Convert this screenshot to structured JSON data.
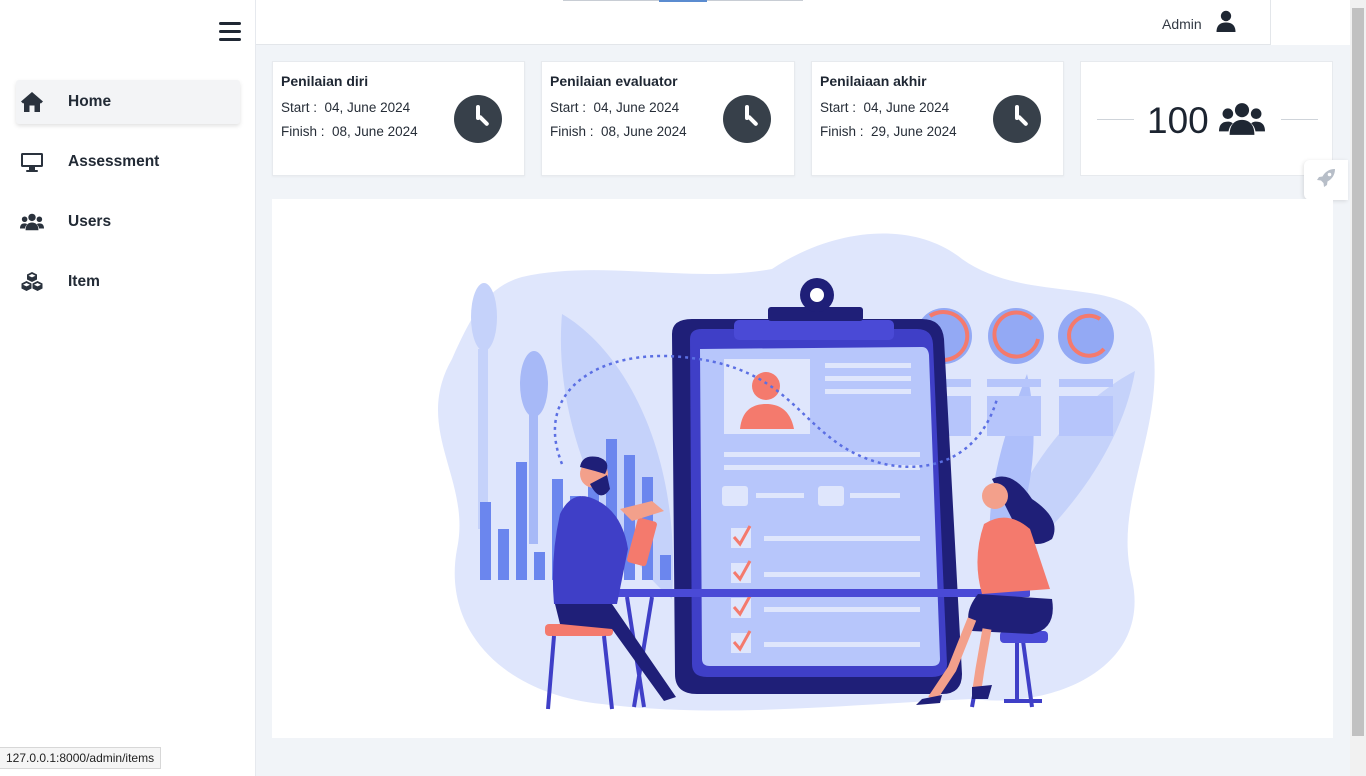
{
  "sidebar": {
    "items": [
      {
        "label": "Home",
        "icon": "home-icon",
        "active": true
      },
      {
        "label": "Assessment",
        "icon": "monitor-icon",
        "active": false
      },
      {
        "label": "Users",
        "icon": "users-icon",
        "active": false
      },
      {
        "label": "Item",
        "icon": "cubes-icon",
        "active": false
      }
    ]
  },
  "header": {
    "user_name": "Admin",
    "user_icon": "user-icon"
  },
  "cards": [
    {
      "title": "Penilaian diri",
      "start_label": "Start :",
      "start": "04, June 2024",
      "finish_label": "Finish :",
      "finish": "08, June 2024",
      "icon": "clock-icon"
    },
    {
      "title": "Penilaian evaluator",
      "start_label": "Start :",
      "start": "04, June 2024",
      "finish_label": "Finish :",
      "finish": "08, June 2024",
      "icon": "clock-icon"
    },
    {
      "title": "Penilaiaan akhir",
      "start_label": "Start :",
      "start": "04, June 2024",
      "finish_label": "Finish :",
      "finish": "29, June 2024",
      "icon": "clock-icon"
    }
  ],
  "stat": {
    "value": "100",
    "icon": "users-icon"
  },
  "colors": {
    "accent": "#37404a",
    "illustration_primary": "#3f3fc7",
    "illustration_light": "#c9d6fb",
    "illustration_coral": "#f47a6d"
  },
  "status_bar": {
    "url": "127.0.0.1:8000/admin/items"
  }
}
